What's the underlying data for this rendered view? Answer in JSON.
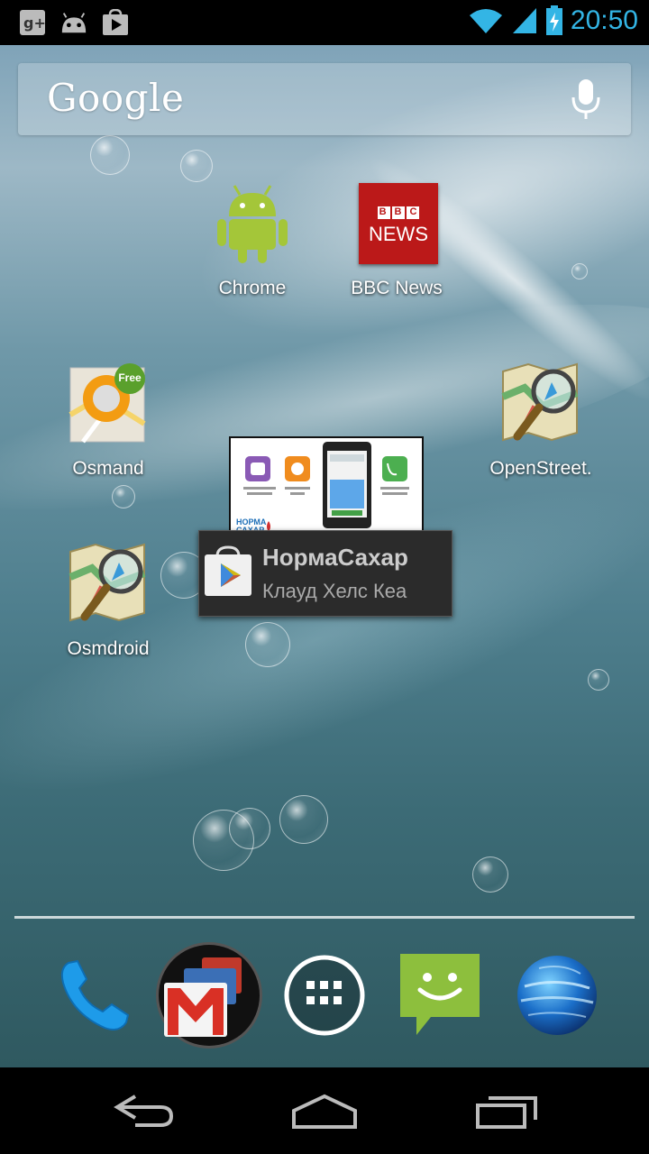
{
  "status_bar": {
    "time": "20:50",
    "left_icons": [
      "google-plus-icon",
      "android-icon",
      "play-store-icon"
    ],
    "right_icons": [
      "wifi-icon",
      "signal-icon",
      "battery-charging-icon"
    ]
  },
  "search": {
    "logo_text": "Google",
    "mic_icon": "mic-icon"
  },
  "apps": {
    "chrome": {
      "label": "Chrome",
      "icon": "android-robot-icon"
    },
    "bbc": {
      "label": "BBC News",
      "icon": "bbc-news-icon",
      "logo_top": "BBC",
      "logo_bottom": "NEWS"
    },
    "osmand": {
      "label": "Osmand",
      "icon": "osmand-icon",
      "badge": "Free"
    },
    "openstreet": {
      "label": "OpenStreet.",
      "icon": "map-magnifier-icon"
    },
    "osmdroid": {
      "label": "Osmdroid",
      "icon": "map-magnifier-icon"
    }
  },
  "install_popup": {
    "title": "НормаСахар",
    "subtitle": "Клауд Хелс Кеа",
    "icon": "play-store-bag-icon",
    "preview_brand": "НОРМА САХАР"
  },
  "dock": {
    "items": [
      "phone-icon",
      "gmail-folder-icon",
      "app-drawer-icon",
      "messaging-icon",
      "browser-globe-icon"
    ]
  },
  "nav": {
    "buttons": [
      "back-icon",
      "home-icon",
      "recents-icon"
    ]
  },
  "colors": {
    "status_accent": "#33b5e5",
    "bbc_red": "#bb1919",
    "android_green": "#a4c639",
    "messaging_green": "#8dbf3d"
  }
}
